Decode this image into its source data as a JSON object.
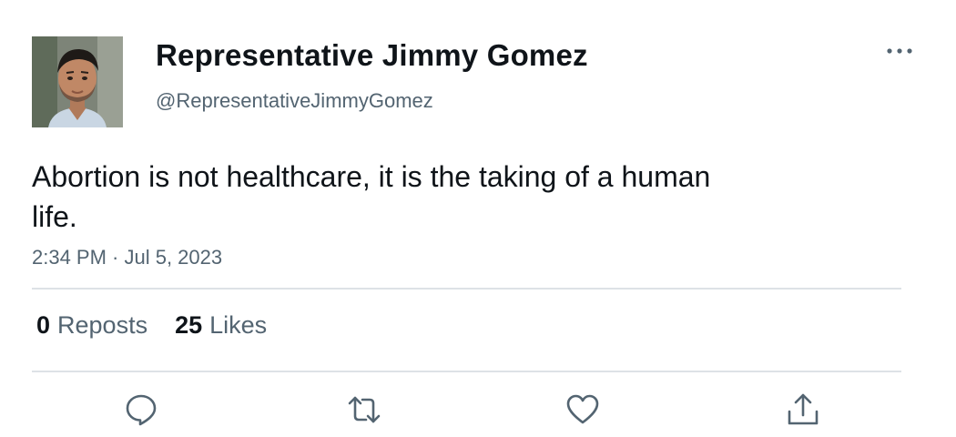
{
  "author": {
    "display_name": "Representative Jimmy Gomez",
    "handle": "@RepresentativeJimmyGomez",
    "avatar_icon": "profile-photo"
  },
  "tweet": {
    "text": "Abortion is not healthcare, it is the taking of a human life.",
    "timestamp": "2:34 PM · Jul 5, 2023"
  },
  "stats": {
    "reposts_count": "0",
    "reposts_label": "Reposts",
    "likes_count": "25",
    "likes_label": "Likes"
  },
  "actions": [
    {
      "icon": "reply-icon"
    },
    {
      "icon": "repost-icon"
    },
    {
      "icon": "like-icon"
    },
    {
      "icon": "share-icon"
    }
  ],
  "colors": {
    "text_primary": "#0f1419",
    "text_secondary": "#536471",
    "divider": "#dde2e6",
    "icon": "#536471"
  }
}
